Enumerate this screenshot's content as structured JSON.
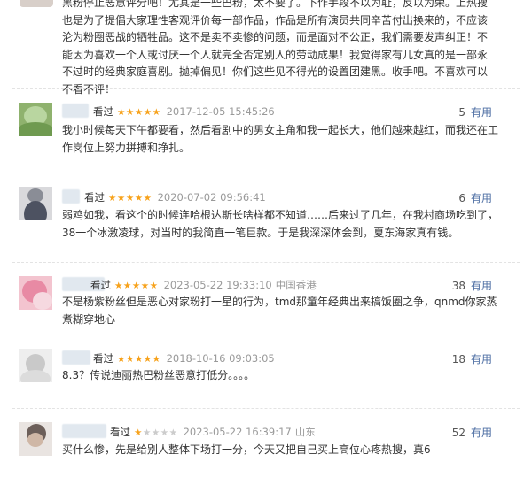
{
  "first_review": {
    "text": "黑粉停止恶意评分吧！尤其是一些巴粉，太不要了。下作手段不以为耻，反以为荣。上热搜也是为了提倡大家理性客观评价每一部作品，作品是所有演员共同辛苦付出换来的，不应该沦为粉圈恶战的牺牲品。这不是卖不卖惨的问题，而是面对不公正，我们需要发声纠正！不能因为喜欢一个人或讨厌一个人就完全否定别人的劳动成果！我觉得家有儿女真的是一部永不过时的经典家庭喜剧。抛掉偏见！你们这些见不得光的设置团建黑。收手吧。不喜欢可以不看不评！"
  },
  "reviews": [
    {
      "watched": "看过",
      "stars": "★★★★★",
      "stars_off": "",
      "time": "2017-12-05 15:45:26",
      "location": "",
      "useful_count": "5",
      "useful_label": "有用",
      "content": "我小时候每天下午都要看，然后看剧中的男女主角和我一起长大，他们越来越红，而我还在工作岗位上努力拼搏和挣扎。"
    },
    {
      "watched": "看过",
      "stars": "★★★★★",
      "stars_off": "",
      "time": "2020-07-02 09:56:41",
      "location": "",
      "useful_count": "6",
      "useful_label": "有用",
      "content": "弱鸡如我，看这个的时候连哈根达斯长啥样都不知道……后来过了几年，在我村商场吃到了，38一个冰激凌球，对当时的我简直一笔巨款。于是我深深体会到，夏东海家真有钱。"
    },
    {
      "watched": "看过",
      "stars": "★★★★★",
      "stars_off": "",
      "time": "2023-05-22 19:33:10",
      "location": "中国香港",
      "useful_count": "38",
      "useful_label": "有用",
      "content": "不是杨紫粉丝但是恶心对家粉打一星的行为，tmd那童年经典出来搞饭圈之争，qnmd你家蒸煮糊穿地心"
    },
    {
      "watched": "看过",
      "stars": "★★★★★",
      "stars_off": "",
      "time": "2018-10-16 09:03:05",
      "location": "",
      "useful_count": "18",
      "useful_label": "有用",
      "content": "8.3？传说迪丽热巴粉丝恶意打低分。。。。"
    },
    {
      "watched": "看过",
      "stars": "★",
      "stars_off": "★★★★",
      "time": "2023-05-22 16:39:17",
      "location": "山东",
      "useful_count": "52",
      "useful_label": "有用",
      "content": "买什么惨，先是给别人整体下场打一分，今天又把自己买上高位心疼热搜，真6"
    }
  ],
  "colors": {
    "star": "#f7a21b",
    "star_off": "#cccccc",
    "useful": "#4d6ea3",
    "meta": "#999999"
  }
}
